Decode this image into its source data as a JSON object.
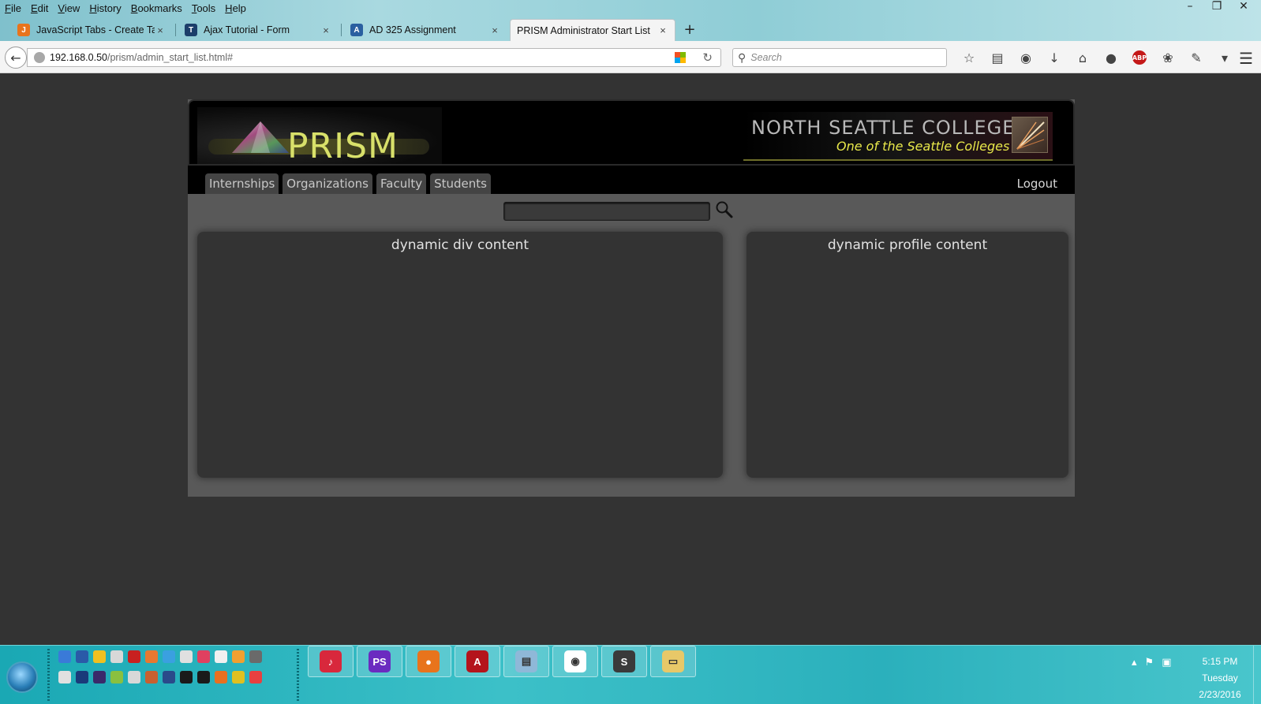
{
  "menubar": {
    "items": [
      "File",
      "Edit",
      "View",
      "History",
      "Bookmarks",
      "Tools",
      "Help"
    ]
  },
  "tabs": [
    {
      "label": "JavaScript Tabs - Create Ta...",
      "color": "#e8741c",
      "glyph": "J",
      "active": false
    },
    {
      "label": "Ajax Tutorial - Form",
      "color": "#1c3e6a",
      "glyph": "T",
      "active": false
    },
    {
      "label": "AD 325 Assignment",
      "color": "#2a5fa0",
      "glyph": "A",
      "active": false
    },
    {
      "label": "PRISM Administrator Start List",
      "color": "",
      "glyph": "",
      "active": true
    }
  ],
  "tab_close_glyph": "×",
  "new_tab_glyph": "+",
  "navbar": {
    "url_host": "192.168.0.50",
    "url_path": "/prism/admin_start_list.html#",
    "search_placeholder": "Search"
  },
  "app": {
    "logo_text": "PRISM",
    "college_title": "NORTH SEATTLE COLLEGE",
    "college_subtitle": "One of the Seattle Colleges",
    "nav_tabs": [
      "Internships",
      "Organizations",
      "Faculty",
      "Students"
    ],
    "logout": "Logout",
    "left_panel_title": "dynamic div content",
    "right_panel_title": "dynamic profile content"
  },
  "taskbar": {
    "apps": [
      {
        "name": "itunes",
        "color": "#d8283c",
        "glyph": "♪"
      },
      {
        "name": "phpstorm",
        "color": "#6b2bc0",
        "glyph": "PS"
      },
      {
        "name": "firefox",
        "color": "#e8741c",
        "glyph": "●"
      },
      {
        "name": "acrobat",
        "color": "#b4141c",
        "glyph": "A"
      },
      {
        "name": "notepad",
        "color": "#8fb8d8",
        "glyph": "▤"
      },
      {
        "name": "color-picker",
        "color": "#ffffff",
        "glyph": "◉"
      },
      {
        "name": "sublime",
        "color": "#3a3a3a",
        "glyph": "S"
      },
      {
        "name": "explorer",
        "color": "#e8c868",
        "glyph": "▭"
      }
    ],
    "clock_time": "5:15 PM",
    "clock_day": "Tuesday",
    "clock_date": "2/23/2016"
  },
  "colors": {
    "page_bg": "#333333",
    "app_bg": "#595959",
    "logo_text": "#d8e06a",
    "college_subtitle": "#e8e84a",
    "nav_tab_bg": "#444444"
  }
}
